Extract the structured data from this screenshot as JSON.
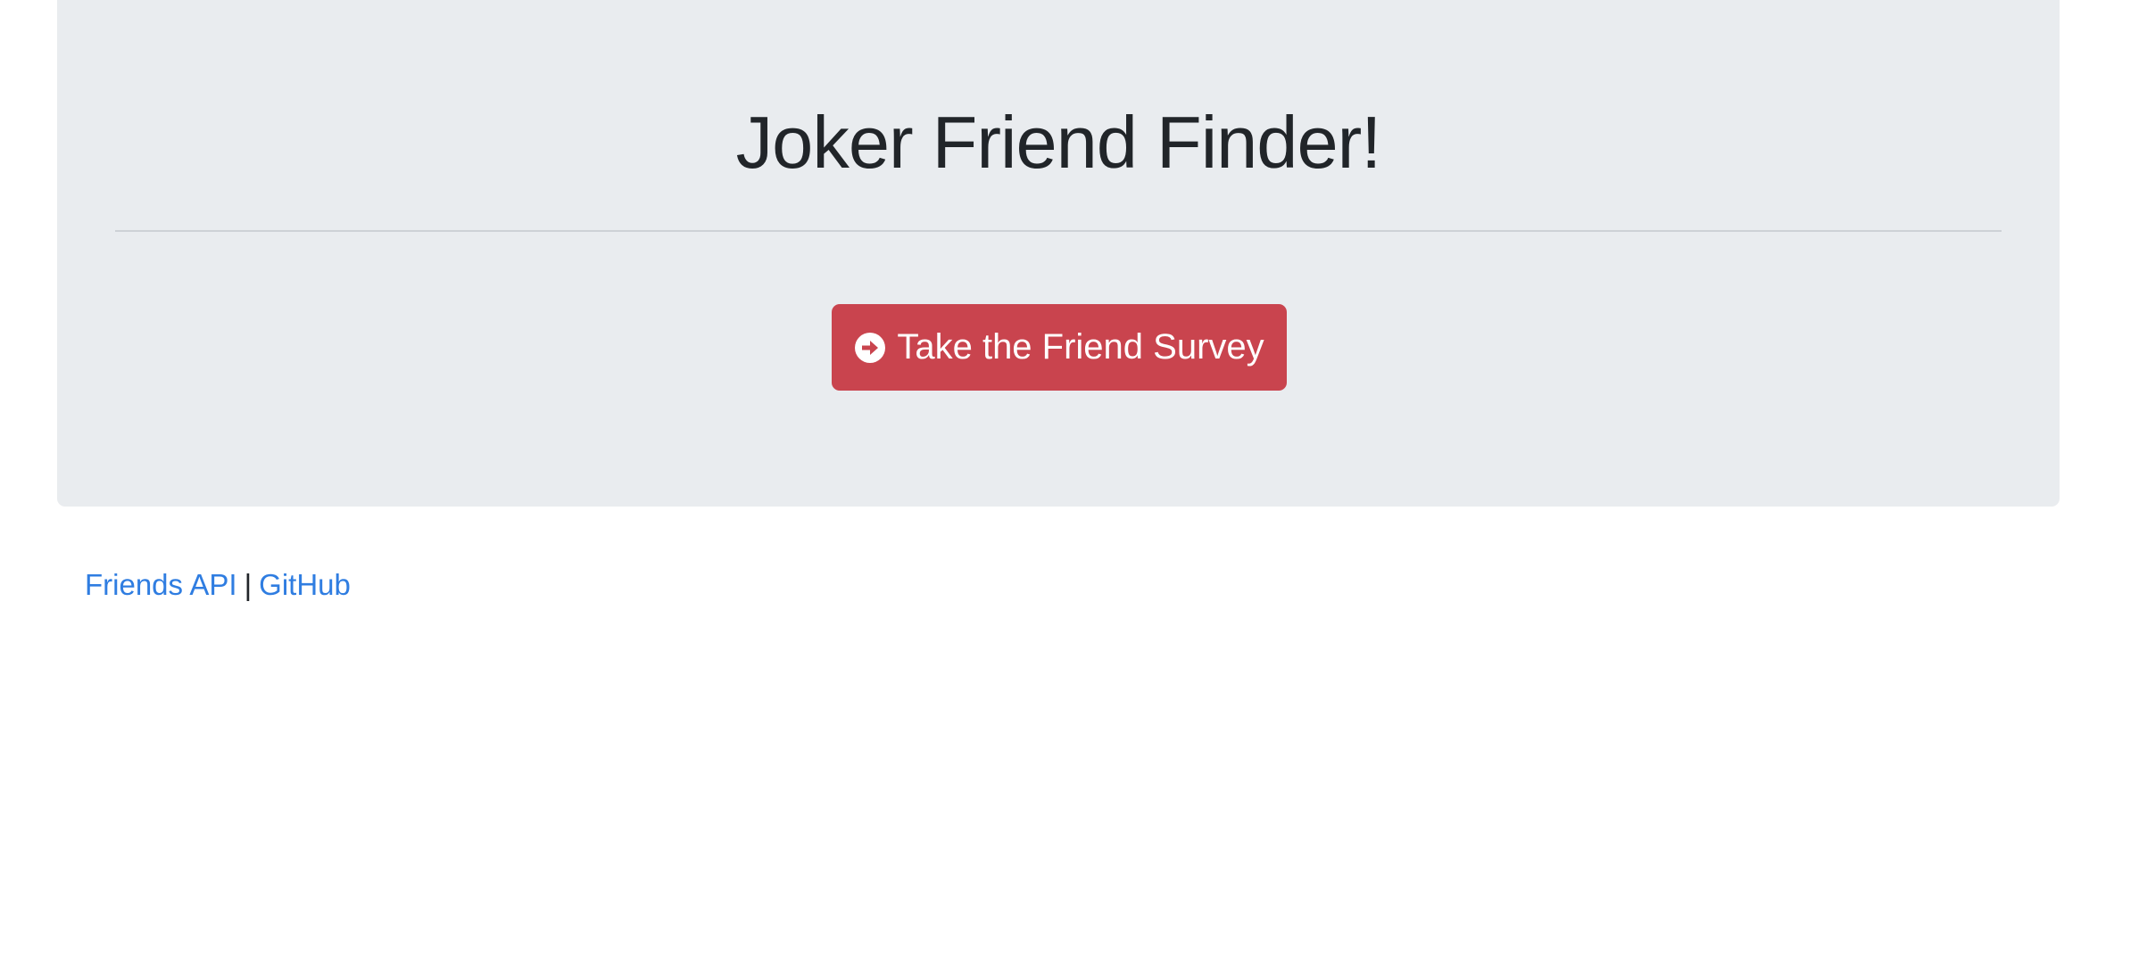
{
  "header": {
    "title": "Joker Friend Finder!"
  },
  "survey_button": {
    "label": "Take the Friend Survey",
    "icon": "arrow-circle-right-icon"
  },
  "footer": {
    "api_link": "Friends API",
    "separator": "|",
    "github_link": "GitHub"
  },
  "colors": {
    "jumbotron_bg": "#e9ecef",
    "button_bg": "#c9444e",
    "link": "#2f7de1",
    "text": "#212529"
  }
}
